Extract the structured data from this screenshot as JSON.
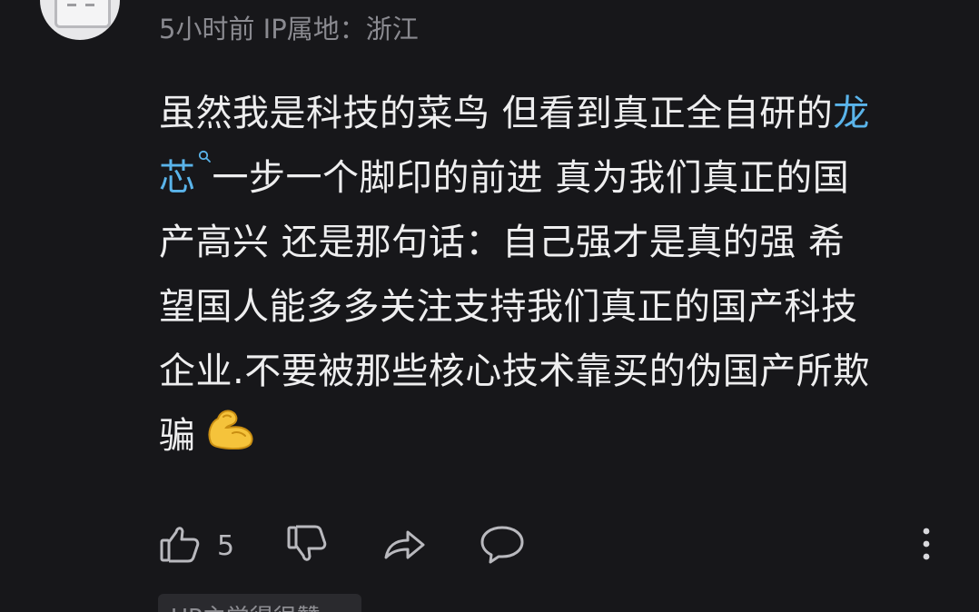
{
  "comment": {
    "meta": "5小时前 IP属地：浙江",
    "lines": [
      {
        "pre": "虽然我是科技的菜鸟 但看到真正全自研的",
        "link": "龙"
      },
      {
        "link": "芯",
        "post": "一步一个脚印的前进 真为我们真正的国"
      },
      {
        "text": "产高兴 还是那句话：自己强才是真的强 希"
      },
      {
        "text": "望国人能多多关注支持我们真正的国产科技"
      },
      {
        "text": "企业.不要被那些核心技术靠买的伪国产所欺"
      },
      {
        "text": "骗"
      }
    ],
    "emoji": "flexed-biceps-emoji"
  },
  "actions": {
    "like_count": "5",
    "icons": {
      "like": "thumbs-up-icon",
      "dislike": "thumbs-down-icon",
      "share": "share-arrow-icon",
      "reply": "chat-bubble-icon",
      "more": "more-vertical-icon"
    }
  },
  "bottom_chip": {
    "label": "UP主觉得很赞"
  },
  "colors": {
    "background": "#17171a",
    "text": "#eeeeef",
    "meta": "#8a8a90",
    "link": "#5ab4ea",
    "icon": "#b9b9be"
  }
}
